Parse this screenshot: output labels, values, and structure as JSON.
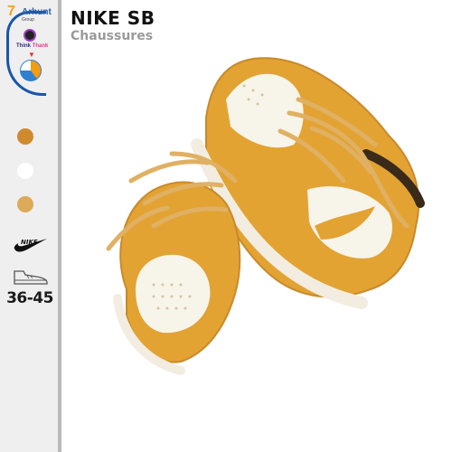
{
  "brand": {
    "logo_seven": "7",
    "logo_name": "Arhunt",
    "logo_group": "Group",
    "think_first": "Think",
    "think_second": "Thank"
  },
  "header": {
    "title": "NIKE SB",
    "subtitle": "Chaussures"
  },
  "color_options": [
    "#d08a2e",
    "#ffffff",
    "#ddaa59"
  ],
  "brand_mark": "nike-swoosh-icon",
  "size_icon": "shoe-icon",
  "size_range": "36-45",
  "product_colors": {
    "leather": "#e2a333",
    "white": "#f7f4ea",
    "laces": "#e0b063"
  }
}
